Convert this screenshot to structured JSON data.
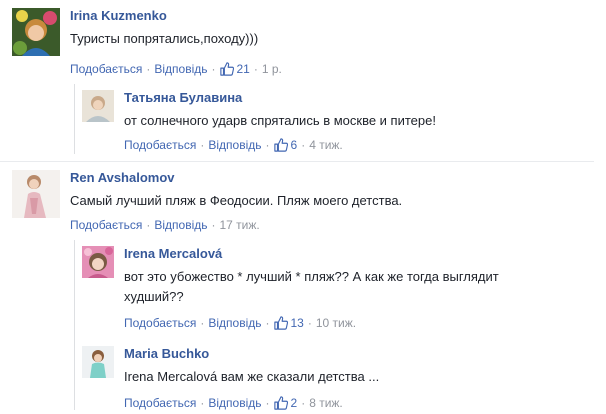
{
  "comments": [
    {
      "author": "Irina Kuzmenko",
      "text": "Туристы попрятались,походу)))",
      "like_label": "Подобається",
      "reply_label": "Відповідь",
      "like_count": "21",
      "time": "1 р.",
      "avatar_icon": "avatar-photo-woman"
    },
    {
      "author": "Татьяна Булавина",
      "text": "от солнечного ударв спрятались в москве и питере!",
      "like_label": "Подобається",
      "reply_label": "Відповідь",
      "like_count": "6",
      "time": "4 тиж.",
      "avatar_icon": "avatar-photo-woman"
    },
    {
      "author": "Ren Avshalomov",
      "text": "Самый лучший пляж в Феодосии. Пляж моего детства.",
      "like_label": "Подобається",
      "reply_label": "Відповідь",
      "time": "17 тиж.",
      "avatar_icon": "avatar-photo-woman"
    },
    {
      "author": "Irena Mercalová",
      "text_line1": "вот это убожество * лучший * пляж?? А как же тогда выглядит",
      "text_line2": "худший??",
      "like_label": "Подобається",
      "reply_label": "Відповідь",
      "like_count": "13",
      "time": "10 тиж.",
      "avatar_icon": "avatar-photo-woman"
    },
    {
      "author": "Maria Buchko",
      "text": "Irena Mercalová вам же сказали детства ...",
      "like_label": "Подобається",
      "reply_label": "Відповідь",
      "like_count": "2",
      "time": "8 тиж.",
      "avatar_icon": "avatar-photo-woman"
    }
  ],
  "colors": {
    "author": "#365899",
    "link": "#4267b2",
    "meta": "#90949c",
    "text": "#1d2129",
    "divider": "#e9ebee"
  }
}
